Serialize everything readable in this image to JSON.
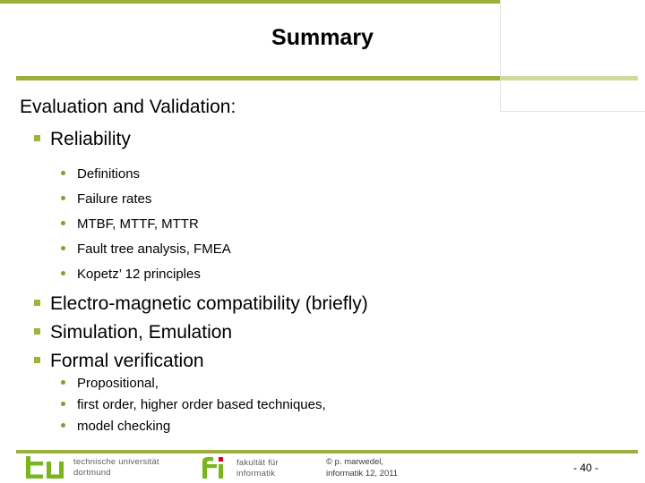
{
  "slide": {
    "title": "Summary",
    "page_number": "- 40 -",
    "accent_color": "#9bb03c",
    "accent_light_color": "#cfdb9c",
    "bullet_square_color": "#a3b23a",
    "bullet_dot_color": "#8f9b27"
  },
  "content": {
    "lead": "Evaluation and Validation:",
    "blocks": [
      {
        "level1": "Reliability",
        "level2": [
          "Definitions",
          "Failure rates",
          "MTBF, MTTF, MTTR",
          "Fault tree analysis, FMEA",
          "Kopetz’ 12 principles"
        ]
      },
      {
        "level1": "Electro-magnetic compatibility (briefly)",
        "level2": []
      },
      {
        "level1": "Simulation, Emulation",
        "level2": []
      },
      {
        "level1": "Formal verification",
        "level2": [
          "Propositional,",
          "first order, higher order based techniques,",
          "model checking"
        ]
      }
    ]
  },
  "footer": {
    "tu_logo": {
      "mark": "tu-wordmark",
      "line1": "technische universität",
      "line2": "dortmund",
      "color": "#7ab51d"
    },
    "fi_logo": {
      "mark": "fi-wordmark",
      "line1": "fakultät für",
      "line2": "informatik",
      "color": "#7ab51d",
      "dot_color": "#e2001a"
    },
    "copyright_line1": "© p. marwedel,",
    "copyright_line2": "informatik 12,  2011"
  }
}
